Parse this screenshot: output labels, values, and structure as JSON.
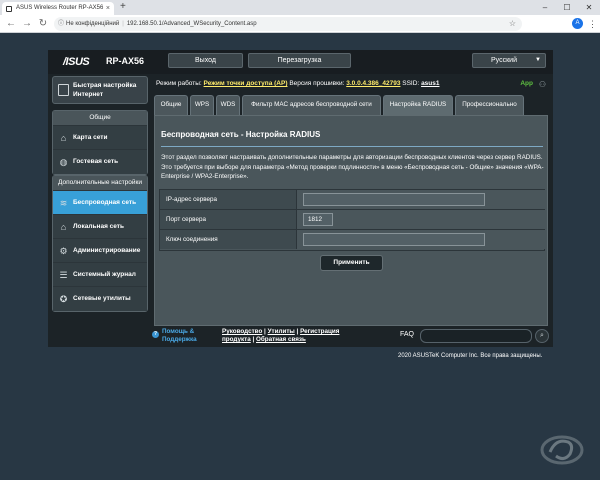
{
  "browser": {
    "tab_title": "ASUS Wireless Router RP-AX56",
    "tab_close": "×",
    "new_tab": "+",
    "win_min": "–",
    "win_max": "☐",
    "win_close": "✕",
    "security_label": "Не конфіденційний",
    "url": "192.168.50.1/Advanced_WSecurity_Content.asp",
    "profile_initial": "A"
  },
  "router": {
    "logo": "/ISUS",
    "model": "RP-AX56",
    "logout_label": "Выход",
    "reboot_label": "Перезагрузка",
    "language": "Русский",
    "status": {
      "mode_label": "Режим работы:",
      "mode_value": "Режим точки доступа (AP)",
      "fw_label": "Версия прошивки:",
      "fw_value": "3.0.0.4.386_42793",
      "ssid_label": "SSID:",
      "ssid_value": "asus1",
      "app_label": "App"
    },
    "sidebar": {
      "qis_label": "Быстрая настройка Интернет",
      "general_title": "Общие",
      "general_items": [
        {
          "label": "Карта сети",
          "icon": "network-map-icon"
        },
        {
          "label": "Гостевая сеть",
          "icon": "guest-network-icon"
        }
      ],
      "advanced_title": "Дополнительные настройки",
      "advanced_items": [
        {
          "label": "Беспроводная сеть",
          "icon": "wireless-icon",
          "active": true
        },
        {
          "label": "Локальная сеть",
          "icon": "lan-icon"
        },
        {
          "label": "Админи­стри­рование",
          "icon": "administration-icon"
        },
        {
          "label": "Системный журнал",
          "icon": "system-log-icon"
        },
        {
          "label": "Сетевые утилиты",
          "icon": "network-tools-icon"
        }
      ]
    },
    "tabs": [
      "Общие",
      "WPS",
      "WDS",
      "Фильтр MAC адресов беспроводной сети",
      "Настройка RADIUS",
      "Профессионально"
    ],
    "active_tab": 4,
    "content": {
      "title": "Беспроводная сеть - Настройка RADIUS",
      "description": "Этот раздел позволяет настраивать дополнительные параметры для авторизации беспроводных клиентов через сервер RADIUS. Это требуется при выборе для параметра «Метод проверки подлинности» в меню «Беспроводная сеть - Общие» значения «WPA-Enterprise / WPA2-Enterprise».",
      "fields": [
        {
          "label": "IP-адрес сервера",
          "value": ""
        },
        {
          "label": "Порт сервера",
          "value": "1812"
        },
        {
          "label": "Ключ соединения",
          "value": ""
        }
      ],
      "apply_label": "Применить"
    },
    "footer": {
      "help_label": "Помощь & Поддержка",
      "links_line1_a": "Руководство",
      "links_line1_b": "Утилиты",
      "links_line1_c": "Регистрация",
      "links_line2_a": "продукта",
      "links_line2_b": "Обратная связь",
      "faq_label": "FAQ"
    },
    "copyright": "2020 ASUSTeK Computer Inc. Все права защищены."
  },
  "colors": {
    "page_bg": "#283744",
    "accent": "#38a0d8",
    "status_value": "#ffec6b",
    "app_green": "#5fc241"
  }
}
